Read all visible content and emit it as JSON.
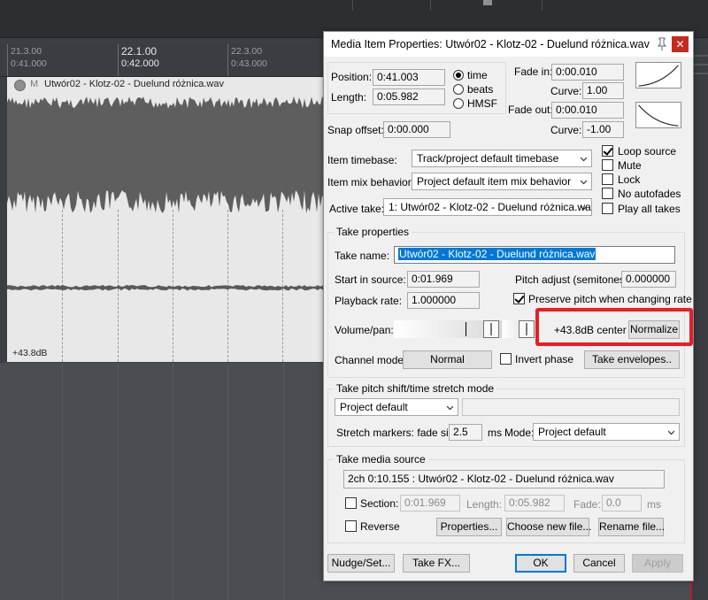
{
  "timeline": {
    "ticks": [
      {
        "bar": "21.3.00",
        "time": "0:41.000",
        "major": false
      },
      {
        "bar": "22.1.00",
        "time": "0:42.000",
        "major": true
      },
      {
        "bar": "22.3.00",
        "time": "0:43.000",
        "major": false
      }
    ]
  },
  "item": {
    "mute_label": "M",
    "name": "Utwór02 - Klotz-02 - Duelund różnica.wav",
    "db_label": "+43.8dB"
  },
  "dialog": {
    "title": "Media Item Properties:  Utwór02 - Klotz-02 - Duelund różnica.wav",
    "close_glyph": "✕",
    "position_label": "Position:",
    "position_value": "0:41.003",
    "length_label": "Length:",
    "length_value": "0:05.982",
    "time_mode": {
      "options": [
        "time",
        "beats",
        "HMSF"
      ],
      "selected": "time"
    },
    "snap_offset_label": "Snap offset:",
    "snap_offset_value": "0:00.000",
    "fade_in_label": "Fade in:",
    "fade_in_value": "0:00.010",
    "fade_in_curve_label": "Curve:",
    "fade_in_curve_value": "1.00",
    "fade_out_label": "Fade out:",
    "fade_out_value": "0:00.010",
    "fade_out_curve_label": "Curve:",
    "fade_out_curve_value": "-1.00",
    "item_timebase_label": "Item timebase:",
    "item_timebase_value": "Track/project default timebase",
    "item_mix_label": "Item mix behavior:",
    "item_mix_value": "Project default item mix behavior",
    "active_take_label": "Active take:",
    "active_take_value": "1: Utwór02 - Klotz-02 - Duelund różnica.wav",
    "options": {
      "loop_source": {
        "label": "Loop source",
        "checked": true
      },
      "mute": {
        "label": "Mute",
        "checked": false
      },
      "lock": {
        "label": "Lock",
        "checked": false
      },
      "no_autofades": {
        "label": "No autofades",
        "checked": false
      },
      "play_all_takes": {
        "label": "Play all takes",
        "checked": false
      }
    },
    "take_props": {
      "group_title": "Take properties",
      "take_name_label": "Take name:",
      "take_name_value": "Utwór02 - Klotz-02 - Duelund różnica.wav",
      "start_label": "Start in source:",
      "start_value": "0:01.969",
      "pitch_label": "Pitch adjust (semitones):",
      "pitch_value": "0.000000",
      "rate_label": "Playback rate:",
      "rate_value": "1.000000",
      "preserve_pitch_label": "Preserve pitch when changing rate",
      "volpan_label": "Volume/pan:",
      "vol_readout": "+43.8dB  center",
      "normalize_label": "Normalize",
      "channel_mode_label": "Channel mode:",
      "channel_mode_value": "Normal",
      "invert_phase_label": "Invert phase",
      "take_envelopes_label": "Take envelopes.."
    },
    "stretch": {
      "group_title": "Take pitch shift/time stretch mode",
      "mode_value": "Project default",
      "markers_label": "Stretch markers: fade size:",
      "fade_size_value": "2.5",
      "ms_label": "ms",
      "mode_label": "Mode:",
      "mode2_value": "Project default"
    },
    "media": {
      "group_title": "Take media source",
      "source_value": "2ch 0:10.155 : Utwór02 - Klotz-02 - Duelund różnica.wav",
      "section_label": "Section:",
      "section_value": "0:01.969",
      "length_label": "Length:",
      "length_value": "0:05.982",
      "fade_label": "Fade:",
      "fade_value": "0.0",
      "ms_label": "ms",
      "reverse_label": "Reverse",
      "properties_btn": "Properties...",
      "choose_btn": "Choose new file...",
      "rename_btn": "Rename file..."
    },
    "footer": {
      "nudge": "Nudge/Set...",
      "take_fx": "Take FX...",
      "ok": "OK",
      "cancel": "Cancel",
      "apply": "Apply"
    }
  },
  "colors": {
    "highlight": "#ec1c24",
    "close": "#c42b1c",
    "selection": "#0078d7"
  }
}
